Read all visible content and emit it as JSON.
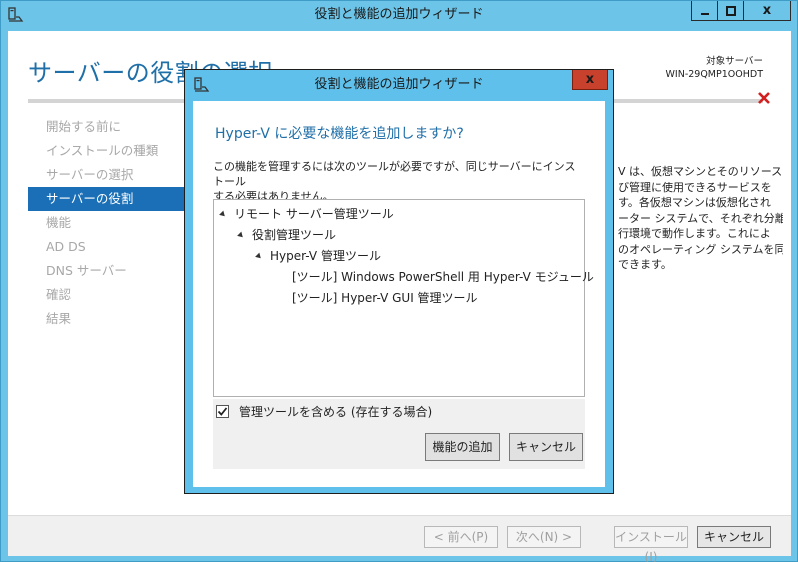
{
  "window": {
    "title": "役割と機能の追加ウィザード",
    "minimize_glyph": "minimize-icon",
    "maximize_glyph": "maximize-icon",
    "close_label": "x"
  },
  "page": {
    "title": "サーバーの役割の選択",
    "target_label": "対象サーバー",
    "target_server": "WIN-29QMP1OOHDT"
  },
  "steps": [
    {
      "label": "開始する前に",
      "active": false
    },
    {
      "label": "インストールの種類",
      "active": false
    },
    {
      "label": "サーバーの選択",
      "active": false
    },
    {
      "label": "サーバーの役割",
      "active": true
    },
    {
      "label": "機能",
      "active": false
    },
    {
      "label": "AD DS",
      "active": false
    },
    {
      "label": "DNS サーバー",
      "active": false
    },
    {
      "label": "確認",
      "active": false
    },
    {
      "label": "結果",
      "active": false
    }
  ],
  "description": [
    "V は、仮想マシンとそのリソースの",
    "び管理に使用できるサービスを",
    "す。各仮想マシンは仮想化され",
    "ーター システムで、それぞれ分離",
    "行環境で動作します。これによ",
    "のオペレーティング システムを同",
    "できます。"
  ],
  "footer": {
    "prev": "< 前へ(P)",
    "next": "次へ(N) >",
    "install": "インストール(I)",
    "cancel": "キャンセル"
  },
  "dialog": {
    "title": "役割と機能の追加ウィザード",
    "close_label": "x",
    "heading": "Hyper-V に必要な機能を追加しますか?",
    "text_line1": "この機能を管理するには次のツールが必要ですが、同じサーバーにインストール",
    "text_line2": "する必要はありません。",
    "tree": [
      {
        "label": "リモート サーバー管理ツール",
        "level": 0,
        "expanded": true
      },
      {
        "label": "役割管理ツール",
        "level": 1,
        "expanded": true
      },
      {
        "label": "Hyper-V 管理ツール",
        "level": 2,
        "expanded": true
      },
      {
        "label": "[ツール] Windows PowerShell 用 Hyper-V モジュール",
        "level": 3,
        "expanded": false
      },
      {
        "label": "[ツール] Hyper-V GUI 管理ツール",
        "level": 3,
        "expanded": false
      }
    ],
    "include_tools_label": "管理ツールを含める (存在する場合)",
    "include_tools_checked": true,
    "add_button": "機能の追加",
    "cancel_button": "キャンセル"
  },
  "colors": {
    "accent": "#1a6fb7",
    "title_blue": "#1f6fa8",
    "chrome": "#6cc4e8",
    "close_red": "#c7412c"
  }
}
